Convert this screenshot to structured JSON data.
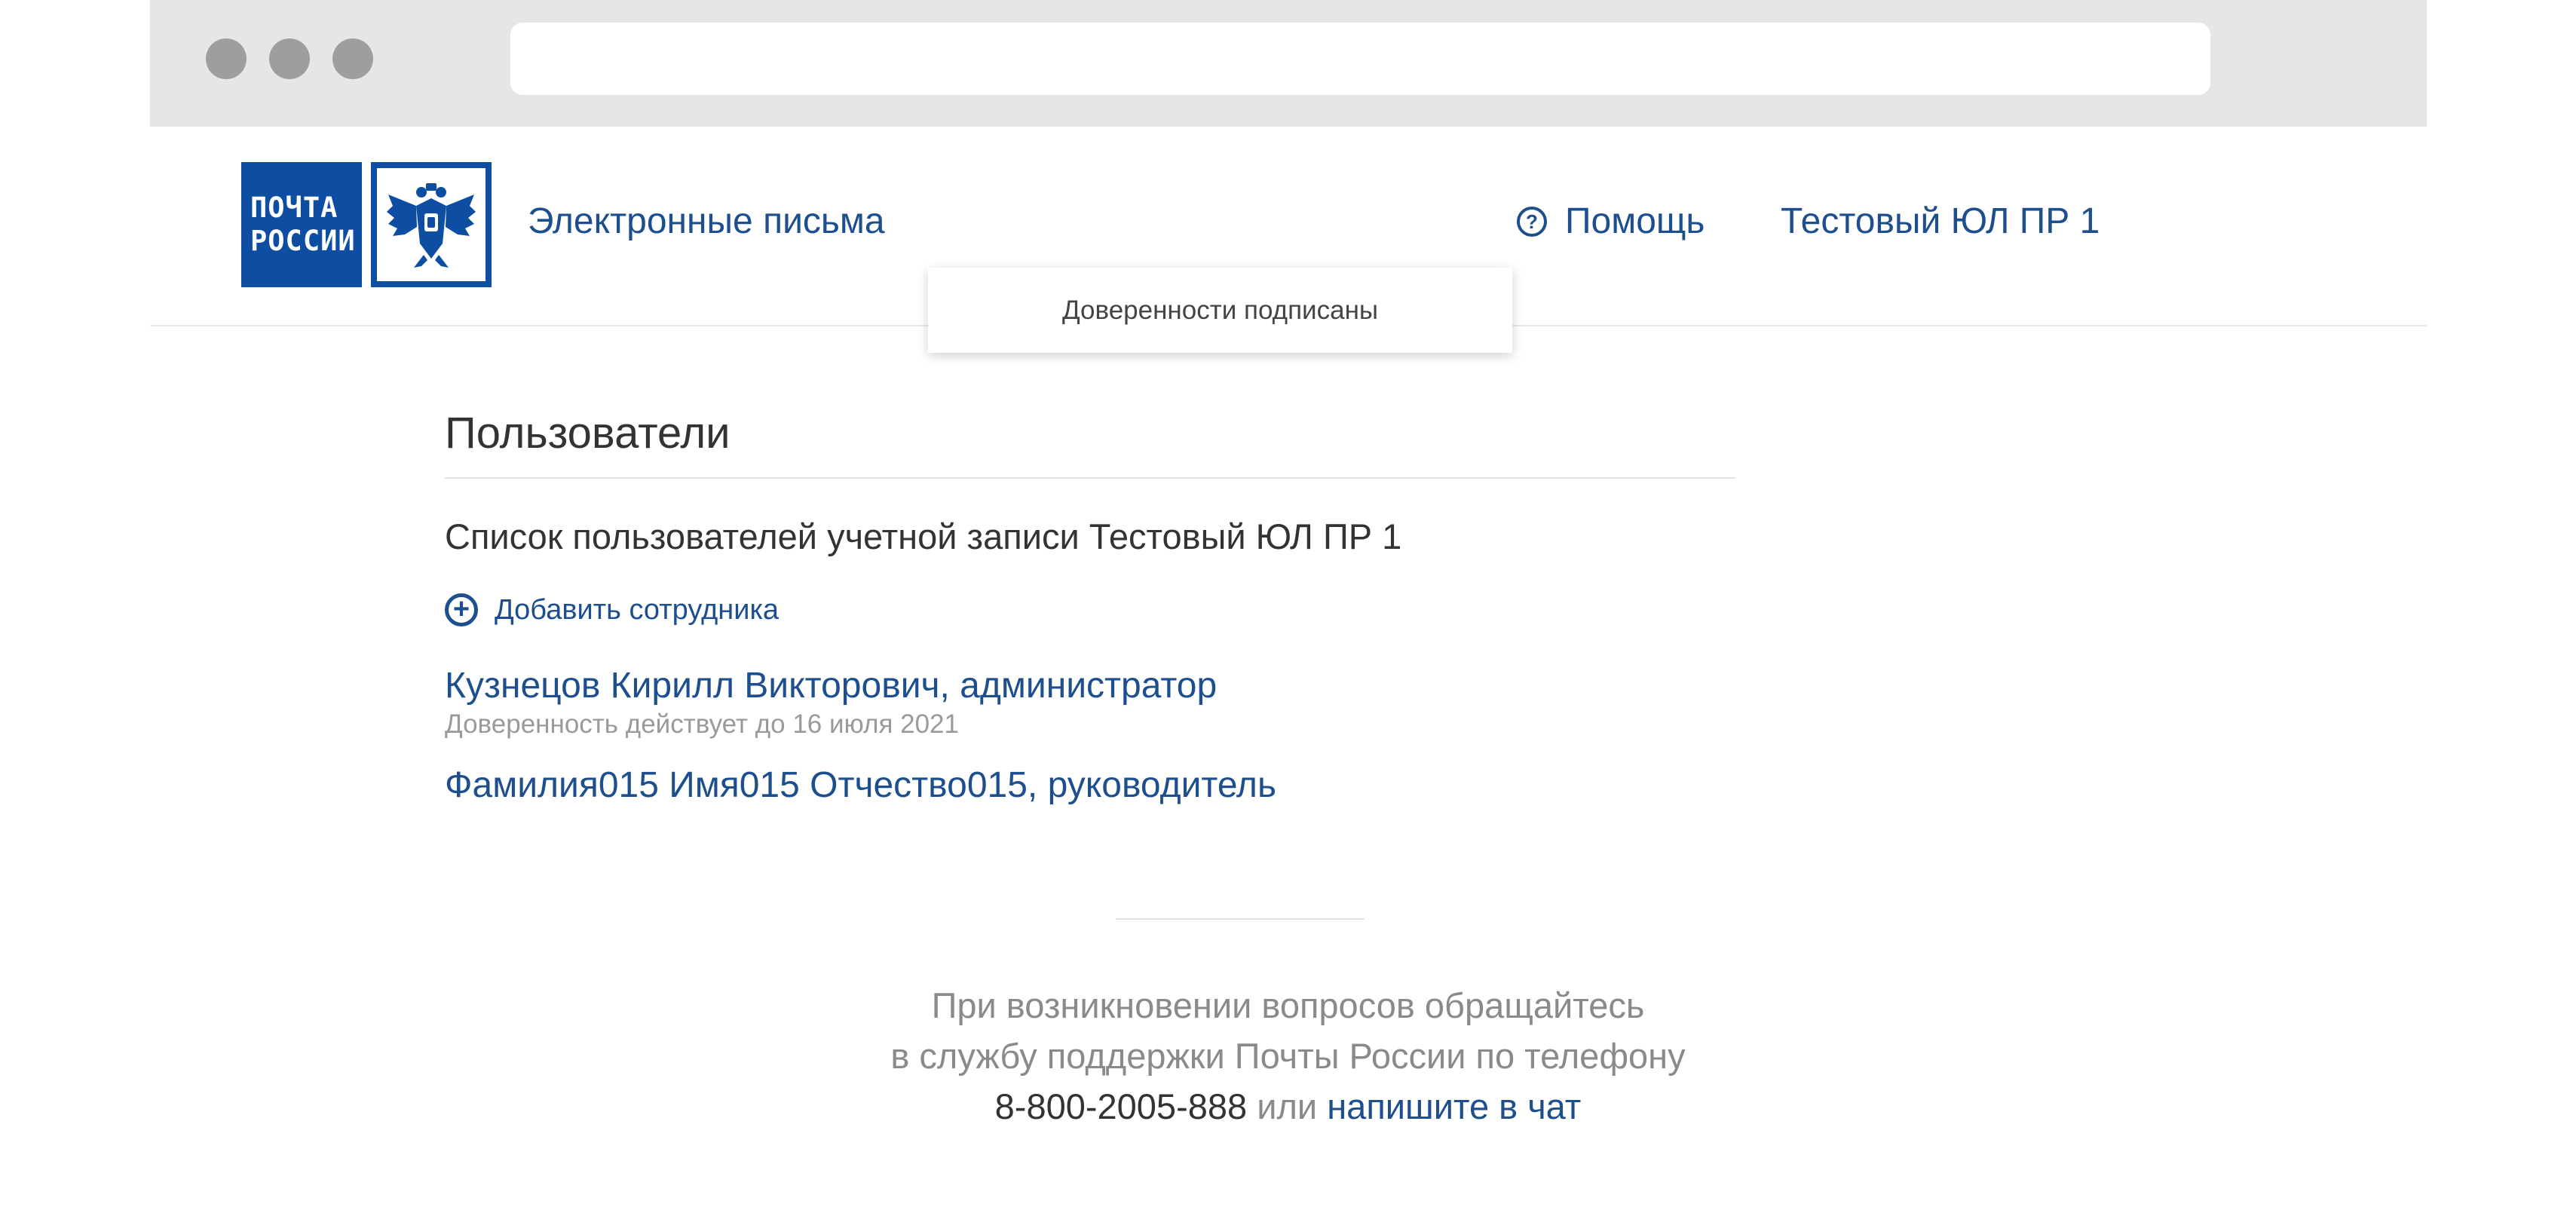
{
  "header": {
    "logo_line1": "ПОЧТА",
    "logo_line2": "РОССИИ",
    "service_link": "Электронные письма",
    "help_icon": "?",
    "help_label": "Помощь",
    "account_name": "Тестовый ЮЛ ПР 1"
  },
  "dropdown": {
    "item": "Доверенности подписаны"
  },
  "main": {
    "title": "Пользователи",
    "subtitle": "Список пользователей учетной записи Тестовый ЮЛ ПР 1",
    "add_icon": "+",
    "add_label": "Добавить сотрудника",
    "users": [
      {
        "name": "Кузнецов Кирилл Викторович, администратор",
        "note": "Доверенность действует до 16 июля 2021"
      },
      {
        "name": "Фамилия015 Имя015 Отчество015, руководитель"
      }
    ]
  },
  "support": {
    "line1": "При возникновении вопросов обращайтесь",
    "line2": "в службу поддержки Почты России по телефону",
    "phone": "8-800-2005-888",
    "or": "или",
    "chat_link": "напишите в чат"
  },
  "icons": {
    "emblem": "double-headed-eagle-icon",
    "help": "help-circle-icon",
    "add": "plus-circle-icon"
  },
  "colors": {
    "brand_blue": "#0d4ea3",
    "link_blue": "#1d4f8f",
    "chrome_gray": "#e6e6e6",
    "dot_gray": "#9e9e9e"
  }
}
